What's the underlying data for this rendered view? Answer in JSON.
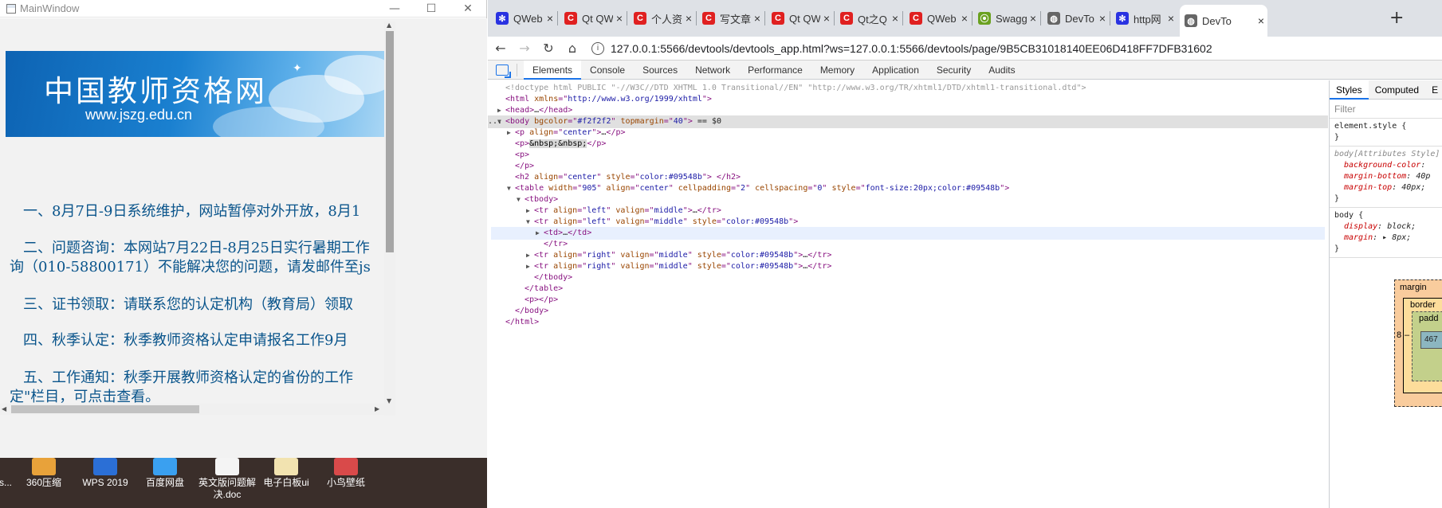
{
  "qt_window": {
    "title": "MainWindow",
    "controls": {
      "minimize": "—",
      "maximize": "☐",
      "close": "✕"
    },
    "banner": {
      "title": "中国教师资格网",
      "url": "www.jszg.edu.cn",
      "star": "✦"
    },
    "notices": [
      "一、8月7日-9日系统维护，网站暂停对外开放，8月1",
      "二、问题咨询：本网站7月22日-8月25日实行暑期工作",
      "询（010-58800171）不能解决您的问题，请发邮件至js",
      "三、证书领取：请联系您的认定机构（教育局）领取",
      "四、秋季认定：秋季教师资格认定申请报名工作9月",
      "五、工作通知：秋季开展教师资格认定的省份的工作",
      "定\"栏目，可点击查看。"
    ]
  },
  "desktop": {
    "icons": [
      {
        "label": "s...",
        "color": "#3a2e2a"
      },
      {
        "label": "360压缩",
        "color": "#e8a23a"
      },
      {
        "label": "WPS 2019",
        "color": "#2b6fd6"
      },
      {
        "label": "百度网盘",
        "color": "#3aa0f0"
      },
      {
        "label": "英文版问题解决.doc",
        "color": "#f4f4f4"
      },
      {
        "label": "电子白板ui",
        "color": "#f2e3b0"
      },
      {
        "label": "小鸟壁纸",
        "color": "#d94a4a"
      }
    ]
  },
  "chrome": {
    "tabs": [
      {
        "label": "QWeb",
        "icon": "baidu-paw-icon",
        "color": "#2932e1",
        "glyph": "✻"
      },
      {
        "label": "Qt QW",
        "icon": "csdn-c-icon",
        "color": "#e02020",
        "glyph": "C"
      },
      {
        "label": "个人资料",
        "icon": "csdn-c-icon",
        "color": "#e02020",
        "glyph": "C"
      },
      {
        "label": "写文章",
        "icon": "csdn-c-icon",
        "color": "#e02020",
        "glyph": "C"
      },
      {
        "label": "Qt QW",
        "icon": "csdn-c-icon",
        "color": "#e02020",
        "glyph": "C"
      },
      {
        "label": "Qt之Q",
        "icon": "csdn-c-icon",
        "color": "#e02020",
        "glyph": "C"
      },
      {
        "label": "QWeb",
        "icon": "csdn-c-icon",
        "color": "#e02020",
        "glyph": "C"
      },
      {
        "label": "Swagg",
        "icon": "swagger-icon",
        "color": "#6aa120",
        "glyph": "⦿"
      },
      {
        "label": "DevTo",
        "icon": "globe-icon",
        "color": "#666666",
        "glyph": "◍"
      },
      {
        "label": "http网",
        "icon": "baidu-paw-icon",
        "color": "#2932e1",
        "glyph": "✻"
      },
      {
        "label": "DevTo",
        "icon": "globe-icon",
        "color": "#666666",
        "glyph": "◍"
      }
    ],
    "active_tab_index": 10,
    "new_tab": "+",
    "nav": {
      "back": "←",
      "forward": "→",
      "reload": "↻",
      "home": "⌂",
      "info": "i"
    },
    "url": "127.0.0.1:5566/devtools/devtools_app.html?ws=127.0.0.1:5566/devtools/page/9B5CB31018140EE06D418FF7DFB31602",
    "devtools_tabs": [
      "Elements",
      "Console",
      "Sources",
      "Network",
      "Performance",
      "Memory",
      "Application",
      "Security",
      "Audits"
    ],
    "active_devtools_tab": "Elements",
    "dom": {
      "doctype": "<!doctype html PUBLIC \"-//W3C//DTD XHTML 1.0 Transitional//EN\" \"http://www.w3.org/TR/xhtml1/DTD/xhtml1-transitional.dtd\">",
      "selected_marker": "== $0",
      "ellipsis": "…",
      "nbsp_text": "&nbsp;&nbsp;",
      "dots": "..."
    },
    "styles": {
      "tabs": [
        "Styles",
        "Computed",
        "E"
      ],
      "filter_placeholder": "Filter",
      "element_style": "element.style {",
      "close_brace": "}",
      "attr_rule": "body[Attributes Style]",
      "attr_props": [
        {
          "name": "background-color",
          "value": ""
        },
        {
          "name": "margin-bottom",
          "value": "40p"
        },
        {
          "name": "margin-top",
          "value": "40px;"
        }
      ],
      "body_rule": "body {",
      "body_props": [
        {
          "name": "display",
          "value": "block;"
        },
        {
          "name": "margin",
          "value": "▸ 8px;"
        }
      ],
      "boxmodel": {
        "margin": "margin",
        "border": "border",
        "padding": "padd",
        "left": "8",
        "dash": "–",
        "content": "467"
      }
    }
  }
}
